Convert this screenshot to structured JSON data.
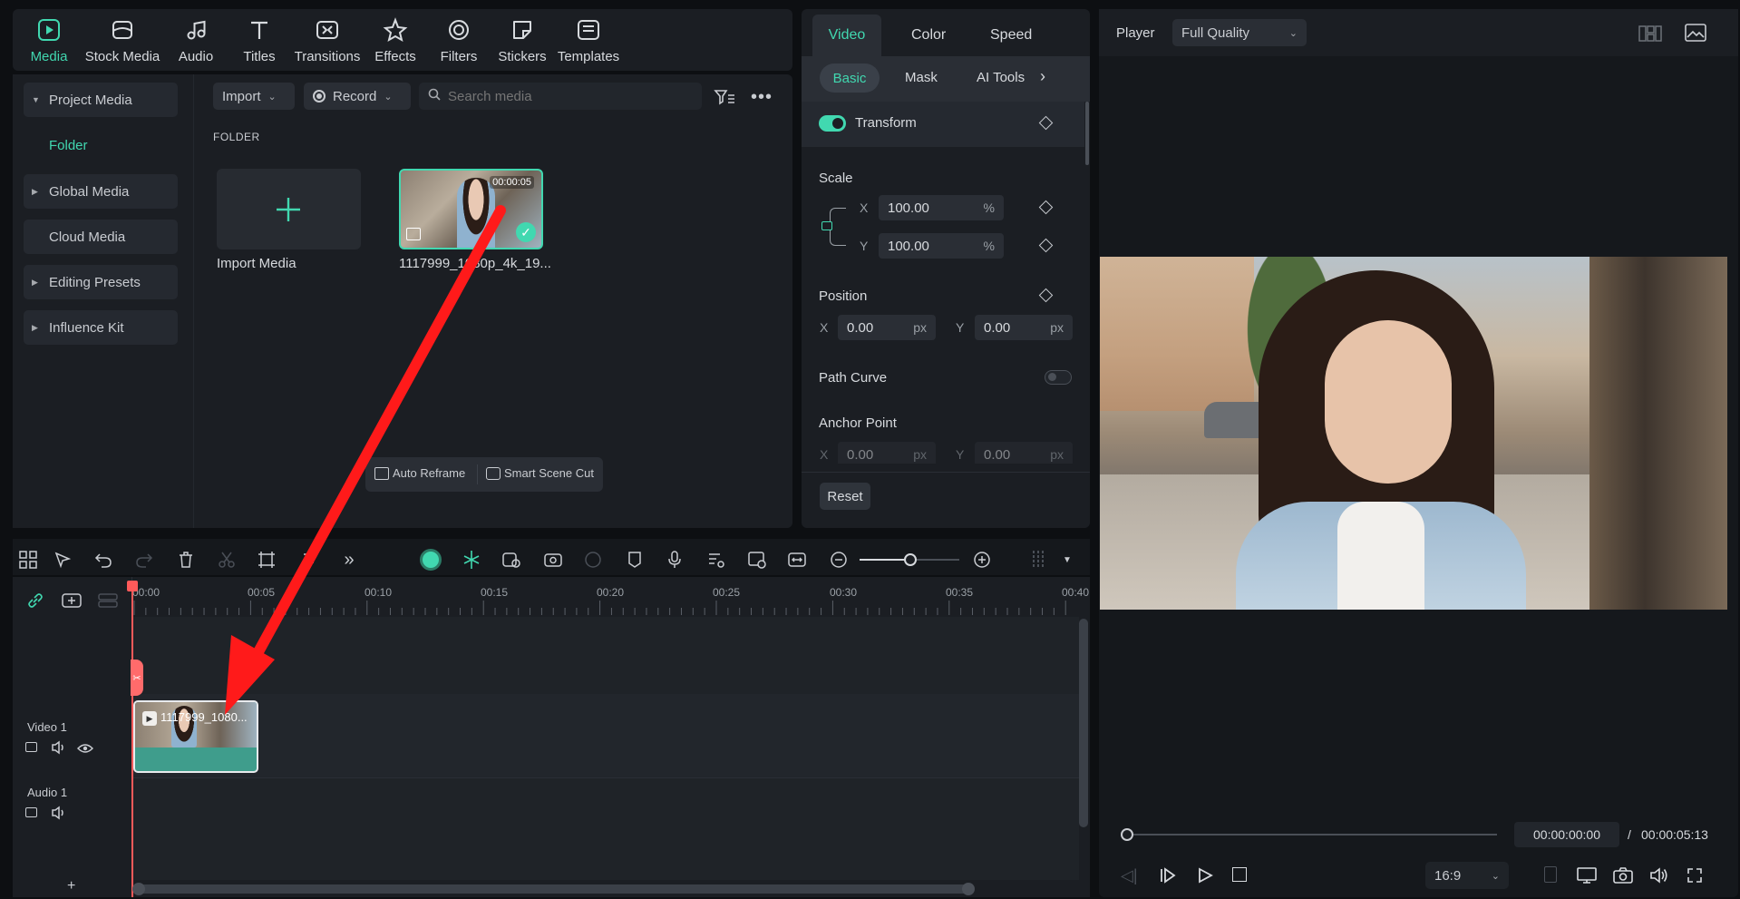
{
  "toolbar": {
    "items": [
      {
        "label": "Media",
        "icon": "media-icon",
        "active": true
      },
      {
        "label": "Stock Media",
        "icon": "stock-media-icon"
      },
      {
        "label": "Audio",
        "icon": "audio-icon"
      },
      {
        "label": "Titles",
        "icon": "titles-icon"
      },
      {
        "label": "Transitions",
        "icon": "transitions-icon"
      },
      {
        "label": "Effects",
        "icon": "effects-icon"
      },
      {
        "label": "Filters",
        "icon": "filters-icon"
      },
      {
        "label": "Stickers",
        "icon": "stickers-icon"
      },
      {
        "label": "Templates",
        "icon": "templates-icon"
      }
    ]
  },
  "sidebar": {
    "items": [
      {
        "label": "Project Media",
        "expanded": true
      },
      {
        "label": "Folder"
      },
      {
        "label": "Global Media"
      },
      {
        "label": "Cloud Media"
      },
      {
        "label": "Editing Presets"
      },
      {
        "label": "Influence Kit"
      }
    ]
  },
  "media": {
    "import_label": "Import",
    "record_label": "Record",
    "search_placeholder": "Search media",
    "folder_heading": "FOLDER",
    "import_media_label": "Import Media",
    "clip_name": "1117999_1080p_4k_19...",
    "clip_duration": "00:00:05",
    "auto_reframe": "Auto Reframe",
    "smart_scene_cut": "Smart Scene Cut"
  },
  "properties": {
    "tabs": [
      "Video",
      "Color",
      "Speed"
    ],
    "subtabs": [
      "Basic",
      "Mask",
      "AI Tools"
    ],
    "transform_label": "Transform",
    "scale_label": "Scale",
    "scale_x": "100.00",
    "scale_y": "100.00",
    "percent": "%",
    "x_label": "X",
    "y_label": "Y",
    "position_label": "Position",
    "pos_x": "0.00",
    "pos_y": "0.00",
    "px": "px",
    "path_curve_label": "Path Curve",
    "anchor_label": "Anchor Point",
    "anchor_x": "0.00",
    "anchor_y": "0.00",
    "reset_label": "Reset"
  },
  "player": {
    "label": "Player",
    "quality": "Full Quality",
    "current_time": "00:00:00:00",
    "separator": "/",
    "total_time": "00:00:05:13",
    "aspect": "16:9",
    "progress": 0
  },
  "timeline": {
    "ticks": [
      "00:00",
      "00:05",
      "00:10",
      "00:15",
      "00:20",
      "00:25",
      "00:30",
      "00:35",
      "00:40"
    ],
    "video_track": "Video 1",
    "audio_track": "Audio 1",
    "clip_label": "1117999_1080...",
    "add_track": "+"
  },
  "colors": {
    "accent": "#41d8b0",
    "panel": "#1b1e23",
    "background": "#0d0f12",
    "playhead": "#ff5a5a",
    "arrow": "#ff1a1a"
  }
}
